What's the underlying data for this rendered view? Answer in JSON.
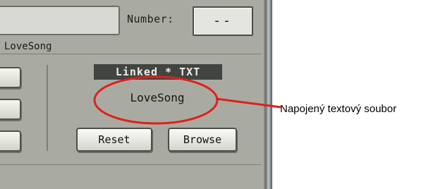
{
  "header": {
    "number_label": "Number:",
    "number_value": "--"
  },
  "song": {
    "caption": "LoveSong"
  },
  "linked": {
    "badge": "Linked * TXT",
    "file_name": "LoveSong"
  },
  "buttons": {
    "reset": "Reset",
    "browse": "Browse"
  },
  "annotation": {
    "text": "Napojený textový soubor",
    "color": "#e0201b"
  },
  "colors": {
    "panel": "#a9aba2",
    "badge": "#424441"
  }
}
